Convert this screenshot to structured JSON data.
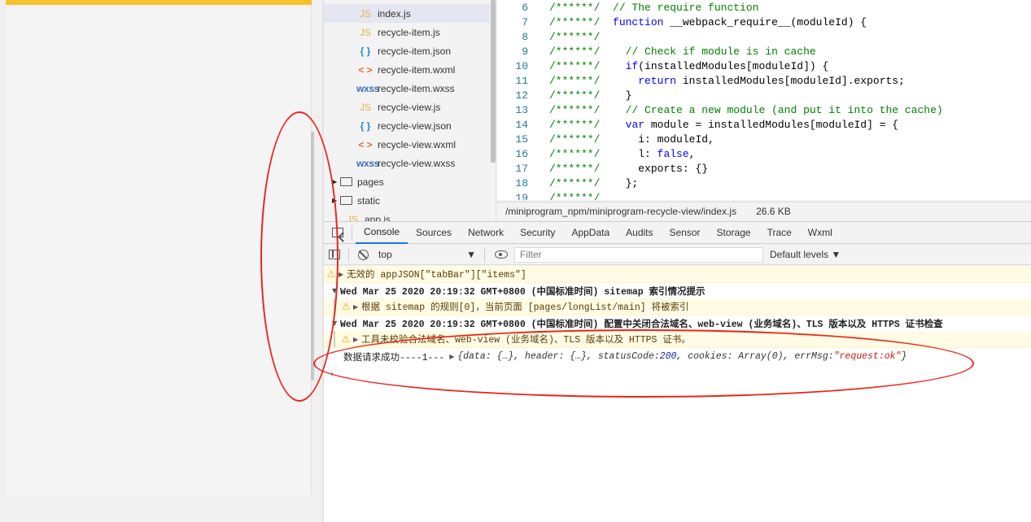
{
  "simulator": {},
  "file_tree": {
    "items": [
      {
        "icon": "js",
        "label": "index.js",
        "selected": true
      },
      {
        "icon": "js",
        "label": "recycle-item.js"
      },
      {
        "icon": "json",
        "label": "recycle-item.json"
      },
      {
        "icon": "wxml",
        "label": "recycle-item.wxml"
      },
      {
        "icon": "wxss",
        "label": "recycle-item.wxss"
      },
      {
        "icon": "js",
        "label": "recycle-view.js"
      },
      {
        "icon": "json",
        "label": "recycle-view.json"
      },
      {
        "icon": "wxml",
        "label": "recycle-view.wxml"
      },
      {
        "icon": "wxss",
        "label": "recycle-view.wxss"
      }
    ],
    "folders": [
      {
        "label": "pages"
      },
      {
        "label": "static"
      }
    ],
    "partial": {
      "label": "app.js"
    },
    "icon_glyphs": {
      "js": "JS",
      "json": "{ }",
      "wxml": "< >",
      "wxss": "wxss"
    }
  },
  "editor": {
    "lines": [
      {
        "n": "6",
        "comment": "/******/",
        "code": [
          [
            "c",
            "// The require function"
          ]
        ]
      },
      {
        "n": "7",
        "comment": "/******/",
        "code": [
          [
            "k",
            "function"
          ],
          [
            "p",
            " __webpack_require__(moduleId) {"
          ]
        ]
      },
      {
        "n": "8",
        "comment": "/******/",
        "code": []
      },
      {
        "n": "9",
        "comment": "/******/",
        "code": [
          [
            "p",
            "  "
          ],
          [
            "c",
            "// Check if module is in cache"
          ]
        ]
      },
      {
        "n": "10",
        "comment": "/******/",
        "code": [
          [
            "p",
            "  "
          ],
          [
            "k",
            "if"
          ],
          [
            "p",
            "(installedModules[moduleId]) {"
          ]
        ]
      },
      {
        "n": "11",
        "comment": "/******/",
        "code": [
          [
            "p",
            "    "
          ],
          [
            "k",
            "return"
          ],
          [
            "p",
            " installedModules[moduleId].exports;"
          ]
        ]
      },
      {
        "n": "12",
        "comment": "/******/",
        "code": [
          [
            "p",
            "  }"
          ]
        ]
      },
      {
        "n": "13",
        "comment": "/******/",
        "code": [
          [
            "p",
            "  "
          ],
          [
            "c",
            "// Create a new module (and put it into the cache)"
          ]
        ]
      },
      {
        "n": "14",
        "comment": "/******/",
        "code": [
          [
            "p",
            "  "
          ],
          [
            "k",
            "var"
          ],
          [
            "p",
            " module = installedModules[moduleId] = {"
          ]
        ]
      },
      {
        "n": "15",
        "comment": "/******/",
        "code": [
          [
            "p",
            "    i: moduleId,"
          ]
        ]
      },
      {
        "n": "16",
        "comment": "/******/",
        "code": [
          [
            "p",
            "    l: "
          ],
          [
            "k",
            "false"
          ],
          [
            "p",
            ","
          ]
        ]
      },
      {
        "n": "17",
        "comment": "/******/",
        "code": [
          [
            "p",
            "    exports: {}"
          ]
        ]
      },
      {
        "n": "18",
        "comment": "/******/",
        "code": [
          [
            "p",
            "  };"
          ]
        ]
      },
      {
        "n": "19",
        "comment": "/******/",
        "code": []
      }
    ],
    "status": {
      "path": "/miniprogram_npm/miniprogram-recycle-view/index.js",
      "size": "26.6 KB"
    }
  },
  "devtools": {
    "tabs": [
      "Console",
      "Sources",
      "Network",
      "Security",
      "AppData",
      "Audits",
      "Sensor",
      "Storage",
      "Trace",
      "Wxml"
    ],
    "active_tab": "Console",
    "context": "top",
    "filter_placeholder": "Filter",
    "levels_label": "Default levels ▼"
  },
  "console": {
    "messages": [
      {
        "type": "warning",
        "text": "无效的 appJSON[\"tabBar\"][\"items\"]"
      },
      {
        "type": "group",
        "text": "Wed Mar 25 2020 20:19:32 GMT+0800 (中国标准时间) sitemap 索引情况提示"
      },
      {
        "type": "warning-child",
        "text": "根据 sitemap 的规则[0]，当前页面 [pages/longList/main] 将被索引"
      },
      {
        "type": "group",
        "text": "Wed Mar 25 2020 20:19:32 GMT+0800 (中国标准时间) 配置中关闭合法域名、web-view (业务域名)、TLS 版本以及 HTTPS 证书检查"
      },
      {
        "type": "warning-child",
        "text": "工具未校验合法域名、web-view (业务域名)、TLS 版本以及 HTTPS 证书。"
      }
    ],
    "log": {
      "prefix": "数据请求成功----1---",
      "obj_head": "{data: {…}, header: {…}, statusCode: ",
      "status_code": "200",
      "obj_mid": ", cookies: Array(0), errMsg: ",
      "err_msg": "\"request:ok\"",
      "obj_tail": "}"
    },
    "prompt": "›"
  },
  "colors": {
    "accent": "#f7c12b",
    "annotation": "#e8261c",
    "active_tab": "#1a73e8"
  }
}
